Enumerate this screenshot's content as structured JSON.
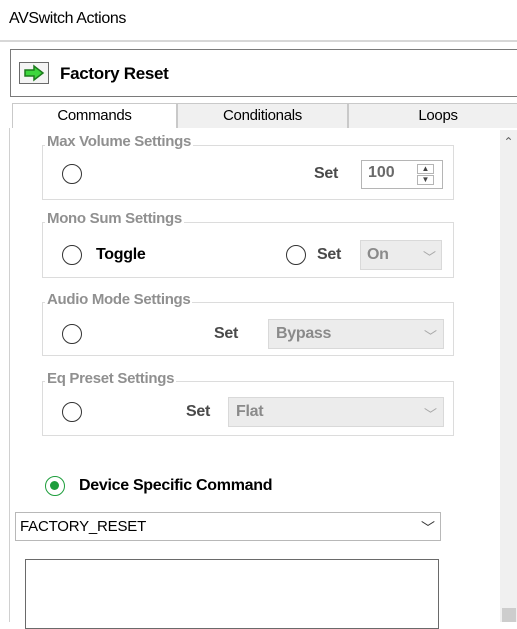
{
  "window": {
    "title": "AVSwitch Actions"
  },
  "action": {
    "name": "Factory Reset",
    "icon": "green-right-arrow-icon"
  },
  "tabs": [
    {
      "label": "Commands",
      "selected": true
    },
    {
      "label": "Conditionals",
      "selected": false
    },
    {
      "label": "Loops",
      "selected": false
    }
  ],
  "groups": {
    "max_volume": {
      "title": "Max Volume Settings",
      "set_label": "Set",
      "value": "100"
    },
    "mono_sum": {
      "title": "Mono Sum Settings",
      "toggle_label": "Toggle",
      "set_label": "Set",
      "value": "On"
    },
    "audio_mode": {
      "title": "Audio Mode Settings",
      "set_label": "Set",
      "value": "Bypass"
    },
    "eq_preset": {
      "title": "Eq Preset Settings",
      "set_label": "Set",
      "value": "Flat"
    }
  },
  "device_specific": {
    "label": "Device Specific Command",
    "selected": true,
    "command": "FACTORY_RESET"
  },
  "colors": {
    "accent_green": "#1e9e3c",
    "disabled_text": "#909090"
  }
}
